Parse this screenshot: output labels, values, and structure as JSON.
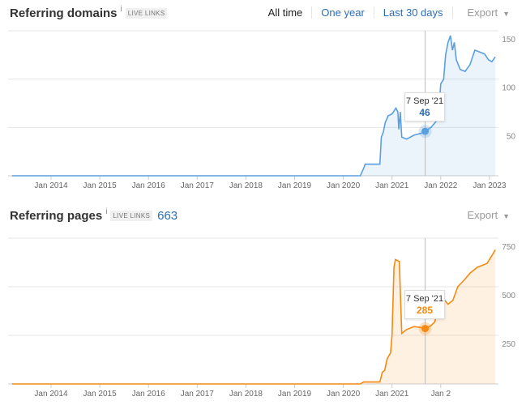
{
  "domains": {
    "title": "Referring domains",
    "info": "i",
    "badge": "LIVE LINKS",
    "tabs": [
      "All time",
      "One year",
      "Last 30 days"
    ],
    "export_label": "Export",
    "tooltip": {
      "date": "7 Sep '21",
      "value": "46"
    }
  },
  "pages": {
    "title": "Referring pages",
    "info": "i",
    "badge": "LIVE LINKS",
    "count": "663",
    "export_label": "Export",
    "tooltip": {
      "date": "7 Sep '21",
      "value": "285"
    }
  },
  "chart_data": [
    {
      "type": "area",
      "title": "Referring domains",
      "color": "#5b9fe0",
      "x_ticks": [
        "Jan 2014",
        "Jan 2015",
        "Jan 2016",
        "Jan 2017",
        "Jan 2018",
        "Jan 2019",
        "Jan 2020",
        "Jan 2021",
        "Jan 2022",
        "Jan 2023"
      ],
      "y_ticks": [
        "150",
        "100",
        "50"
      ],
      "ylim": [
        0,
        150
      ],
      "highlight": {
        "x": 2021.68,
        "y": 46
      },
      "points": [
        [
          2013.2,
          0
        ],
        [
          2020.35,
          0
        ],
        [
          2020.42,
          8
        ],
        [
          2020.45,
          12
        ],
        [
          2020.75,
          12
        ],
        [
          2020.78,
          40
        ],
        [
          2020.82,
          45
        ],
        [
          2020.86,
          55
        ],
        [
          2020.92,
          62
        ],
        [
          2021.0,
          64
        ],
        [
          2021.08,
          70
        ],
        [
          2021.12,
          66
        ],
        [
          2021.14,
          48
        ],
        [
          2021.17,
          66
        ],
        [
          2021.2,
          40
        ],
        [
          2021.3,
          38
        ],
        [
          2021.45,
          42
        ],
        [
          2021.6,
          44
        ],
        [
          2021.68,
          46
        ],
        [
          2021.8,
          50
        ],
        [
          2021.9,
          56
        ],
        [
          2021.95,
          60
        ],
        [
          2022.0,
          95
        ],
        [
          2022.06,
          100
        ],
        [
          2022.1,
          125
        ],
        [
          2022.15,
          138
        ],
        [
          2022.2,
          145
        ],
        [
          2022.24,
          130
        ],
        [
          2022.28,
          138
        ],
        [
          2022.32,
          120
        ],
        [
          2022.4,
          110
        ],
        [
          2022.5,
          108
        ],
        [
          2022.6,
          115
        ],
        [
          2022.7,
          130
        ],
        [
          2022.8,
          128
        ],
        [
          2022.9,
          126
        ],
        [
          2022.98,
          120
        ],
        [
          2023.05,
          118
        ],
        [
          2023.12,
          123
        ]
      ]
    },
    {
      "type": "area",
      "title": "Referring pages",
      "color": "#f6890f",
      "x_ticks": [
        "Jan 2014",
        "Jan 2015",
        "Jan 2016",
        "Jan 2017",
        "Jan 2018",
        "Jan 2019",
        "Jan 2020",
        "Jan 2021",
        "Jan 2"
      ],
      "y_ticks": [
        "750",
        "500",
        "250"
      ],
      "ylim": [
        0,
        750
      ],
      "highlight": {
        "x": 2021.68,
        "y": 285
      },
      "points": [
        [
          2013.2,
          0
        ],
        [
          2020.35,
          0
        ],
        [
          2020.42,
          10
        ],
        [
          2020.75,
          10
        ],
        [
          2020.8,
          60
        ],
        [
          2020.85,
          70
        ],
        [
          2020.9,
          130
        ],
        [
          2020.97,
          160
        ],
        [
          2021.0,
          250
        ],
        [
          2021.04,
          600
        ],
        [
          2021.07,
          640
        ],
        [
          2021.15,
          630
        ],
        [
          2021.2,
          260
        ],
        [
          2021.3,
          280
        ],
        [
          2021.45,
          295
        ],
        [
          2021.6,
          290
        ],
        [
          2021.68,
          285
        ],
        [
          2021.8,
          300
        ],
        [
          2021.88,
          320
        ],
        [
          2021.95,
          420
        ],
        [
          2022.05,
          440
        ],
        [
          2022.15,
          410
        ],
        [
          2022.25,
          430
        ],
        [
          2022.35,
          500
        ],
        [
          2022.5,
          540
        ],
        [
          2022.6,
          570
        ],
        [
          2022.75,
          600
        ],
        [
          2022.85,
          610
        ],
        [
          2022.95,
          620
        ],
        [
          2023.05,
          660
        ],
        [
          2023.12,
          690
        ]
      ]
    }
  ]
}
